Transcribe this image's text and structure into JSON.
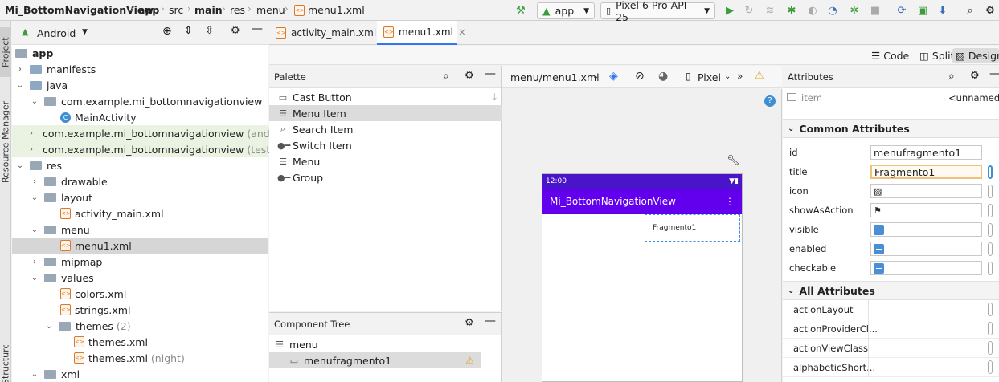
{
  "topbar": {
    "project": "Mi_BottomNavigationView",
    "crumbs": [
      "app",
      "src",
      "main",
      "res",
      "menu",
      "menu1.xml"
    ],
    "run_config": "app",
    "device": "Pixel 6 Pro API 25"
  },
  "side_tabs": {
    "project": "Project",
    "resource_manager": "Resource Manager",
    "structure": "Structure"
  },
  "project_panel": {
    "view_mode": "Android",
    "tree": [
      {
        "label": "app",
        "bold": true
      },
      {
        "label": "manifests"
      },
      {
        "label": "java"
      },
      {
        "label": "com.example.mi_bottomnavigationview"
      },
      {
        "label": "MainActivity"
      },
      {
        "label": "com.example.mi_bottomnavigationview",
        "suffix": "(andr"
      },
      {
        "label": "com.example.mi_bottomnavigationview",
        "suffix": "(test)"
      },
      {
        "label": "res"
      },
      {
        "label": "drawable"
      },
      {
        "label": "layout"
      },
      {
        "label": "activity_main.xml"
      },
      {
        "label": "menu"
      },
      {
        "label": "menu1.xml"
      },
      {
        "label": "mipmap"
      },
      {
        "label": "values"
      },
      {
        "label": "colors.xml"
      },
      {
        "label": "strings.xml"
      },
      {
        "label": "themes",
        "suffix": "(2)"
      },
      {
        "label": "themes.xml"
      },
      {
        "label": "themes.xml",
        "suffix": "(night)"
      },
      {
        "label": "xml"
      }
    ]
  },
  "editor_tabs": [
    {
      "label": "activity_main.xml"
    },
    {
      "label": "menu1.xml"
    }
  ],
  "view_modes": {
    "code": "Code",
    "split": "Split",
    "design": "Design"
  },
  "palette": {
    "title": "Palette",
    "items": [
      "Cast Button",
      "Menu Item",
      "Search Item",
      "Switch Item",
      "Menu",
      "Group"
    ]
  },
  "component_tree": {
    "title": "Component Tree",
    "items": [
      "menu",
      "menufragmento1"
    ]
  },
  "design": {
    "file": "menu/menu1.xml",
    "device": "Pixel",
    "status_time": "12:00",
    "app_title": "Mi_BottomNavigationView",
    "menu_item_text": "Fragmento1"
  },
  "attributes": {
    "title": "Attributes",
    "element_type": "item",
    "element_name": "<unnamed",
    "common_section": "Common Attributes",
    "all_section": "All Attributes",
    "common": [
      {
        "label": "id",
        "value": "menufragmento1"
      },
      {
        "label": "title",
        "value": "Fragmento1"
      },
      {
        "label": "icon",
        "value": ""
      },
      {
        "label": "showAsAction",
        "value": ""
      },
      {
        "label": "visible",
        "value": ""
      },
      {
        "label": "enabled",
        "value": ""
      },
      {
        "label": "checkable",
        "value": ""
      }
    ],
    "all": [
      "actionLayout",
      "actionProviderCl...",
      "actionViewClass",
      "alphabeticShort..."
    ]
  },
  "colors": {
    "accent": "#3574f0",
    "appbar": "#6200ee",
    "statusbar": "#4a14c9",
    "run": "#3c9c3c",
    "warning": "#e5a228"
  }
}
